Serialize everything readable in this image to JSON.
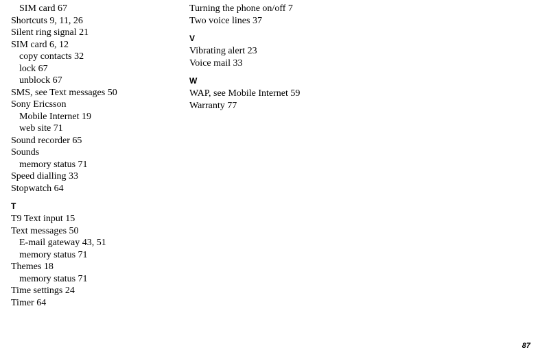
{
  "col1": {
    "sim_card_top": "SIM card 67",
    "shortcuts": "Shortcuts 9, 11, 26",
    "silent_ring": "Silent ring signal 21",
    "sim_card": "SIM card 6, 12",
    "sim_copy": "copy contacts 32",
    "sim_lock": "lock 67",
    "sim_unblock": "unblock 67",
    "sms": "SMS, see Text messages 50",
    "sony_ericsson": "Sony Ericsson",
    "se_mobile": "Mobile Internet 19",
    "se_web": "web site 71",
    "sound_recorder": "Sound recorder 65",
    "sounds": "Sounds",
    "sounds_mem": "memory status 71",
    "speed_dial": "Speed dialling 33",
    "stopwatch": "Stopwatch 64",
    "T": "T",
    "t9": "T9 Text input 15",
    "text_msgs": "Text messages 50",
    "tm_email": "E-mail gateway 43, 51",
    "tm_mem": "memory status 71",
    "themes": "Themes 18",
    "themes_mem": "memory status 71",
    "time": "Time settings 24",
    "timer": "Timer 64"
  },
  "col2": {
    "turning": "Turning the phone on/off 7",
    "two_voice": "Two voice lines 37",
    "V": "V",
    "vibrating": "Vibrating alert 23",
    "voice_mail": "Voice mail 33",
    "W": "W",
    "wap": "WAP, see Mobile Internet 59",
    "warranty": "Warranty 77"
  },
  "page_number": "87"
}
